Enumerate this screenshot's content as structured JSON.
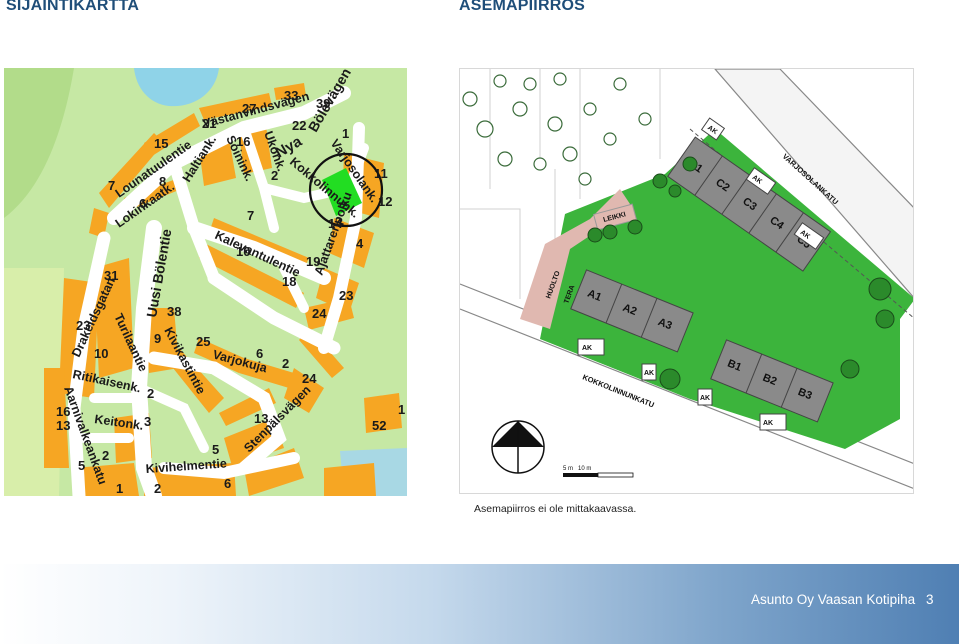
{
  "headings": {
    "left": "SIJAINTIKARTTA",
    "right": "ASEMAPIIRROS"
  },
  "map": {
    "streets": [
      "Västanvindsvägen",
      "Lounatuulentie",
      "Haltiank.",
      "Soinink.",
      "Ukonk.",
      "Nya",
      "Bölevägen",
      "Varjosolank.",
      "Kokkolinnunk.",
      "Lokinkaatk.",
      "Kalevantulentie",
      "Ajattarenpolku",
      "Uusi Bölentie",
      "Kivikastintie",
      "Drakeldsgatan",
      "Turilaantie",
      "Ritikaisenk.",
      "Aarnivalkeankatu",
      "Keitonk.",
      "Varjokuja",
      "Stenpälsvägen",
      "Kivihelmentie"
    ],
    "numbers": [
      "33",
      "27",
      "21",
      "22",
      "39",
      "15",
      "16",
      "1",
      "7",
      "8",
      "6",
      "2",
      "11",
      "12",
      "4",
      "14",
      "19",
      "18",
      "23",
      "24",
      "10",
      "31",
      "38",
      "9",
      "25",
      "23",
      "16",
      "13",
      "5",
      "2",
      "1",
      "24",
      "6",
      "2",
      "3",
      "52",
      "1",
      "2",
      "5",
      "6",
      "2",
      "10",
      "7",
      "13"
    ]
  },
  "plan": {
    "street_labels": [
      "VARJOSOLANKATU",
      "KOKKOLINNUNKATU"
    ],
    "buildings": [
      "C1",
      "C2",
      "C3",
      "C4",
      "C5",
      "A1",
      "A2",
      "A3",
      "B1",
      "B2",
      "B3"
    ],
    "parking": "AK",
    "areas": [
      "LEIKKI",
      "HUOLTO",
      "TERA"
    ],
    "scale": [
      "5 m",
      "10 m"
    ]
  },
  "caption": "Asemapiirros ei ole mittakaavassa.",
  "footer": {
    "title": "Asunto Oy Vaasan Kotipiha",
    "page": "3"
  }
}
